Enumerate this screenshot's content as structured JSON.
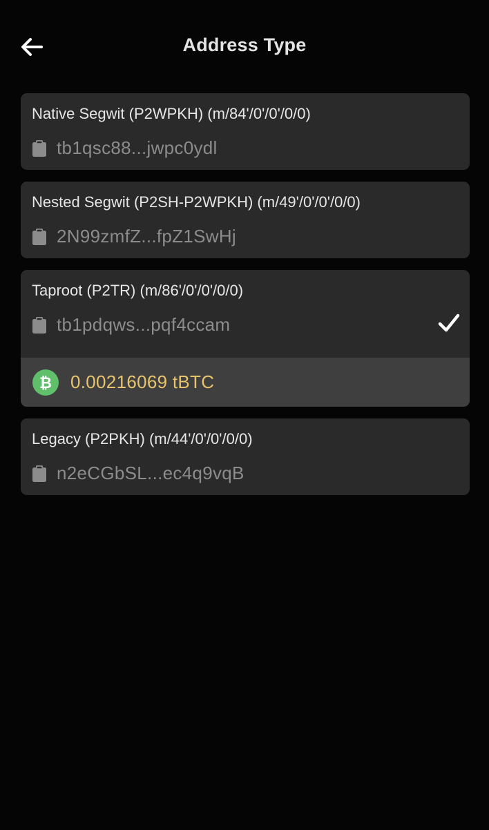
{
  "header": {
    "title": "Address Type",
    "back_icon": "arrow-left-icon"
  },
  "colors": {
    "background": "#050505",
    "card": "#2a2a2a",
    "balance_row": "#3f3f3f",
    "balance_text": "#e9c46a",
    "btc_badge": "#5fbf6a"
  },
  "address_types": [
    {
      "label": "Native Segwit (P2WPKH) (m/84'/0'/0'/0/0)",
      "address": "tb1qsc88...jwpc0ydl",
      "selected": false
    },
    {
      "label": "Nested Segwit (P2SH-P2WPKH) (m/49'/0'/0'/0/0)",
      "address": "2N99zmfZ...fpZ1SwHj",
      "selected": false
    },
    {
      "label": "Taproot (P2TR) (m/86'/0'/0'/0/0)",
      "address": "tb1pdqws...pqf4ccam",
      "selected": true,
      "balance": "0.00216069 tBTC"
    },
    {
      "label": "Legacy (P2PKH) (m/44'/0'/0'/0/0)",
      "address": "n2eCGbSL...ec4q9vqB",
      "selected": false
    }
  ]
}
